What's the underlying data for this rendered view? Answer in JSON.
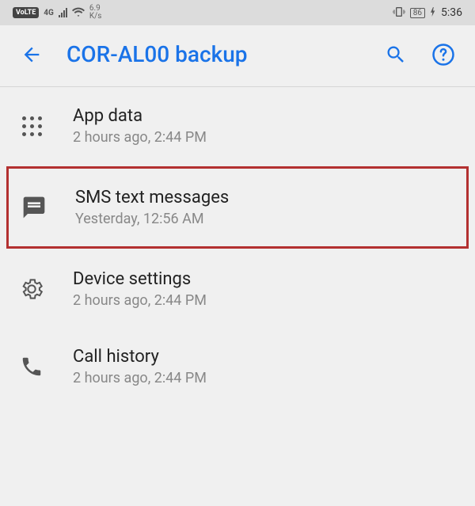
{
  "status": {
    "volte": "VoLTE",
    "network": "4G",
    "speed_value": "6.9",
    "speed_unit": "K/s",
    "battery": "86",
    "time": "5:36"
  },
  "appbar": {
    "title": "COR-AL00 backup"
  },
  "backup_items": [
    {
      "id": "app-data",
      "title": "App data",
      "subtitle": "2 hours ago, 2:44 PM",
      "highlighted": false
    },
    {
      "id": "sms",
      "title": "SMS text messages",
      "subtitle": "Yesterday, 12:56 AM",
      "highlighted": true
    },
    {
      "id": "device-settings",
      "title": "Device settings",
      "subtitle": "2 hours ago, 2:44 PM",
      "highlighted": false
    },
    {
      "id": "call-history",
      "title": "Call history",
      "subtitle": "2 hours ago, 2:44 PM",
      "highlighted": false
    }
  ]
}
